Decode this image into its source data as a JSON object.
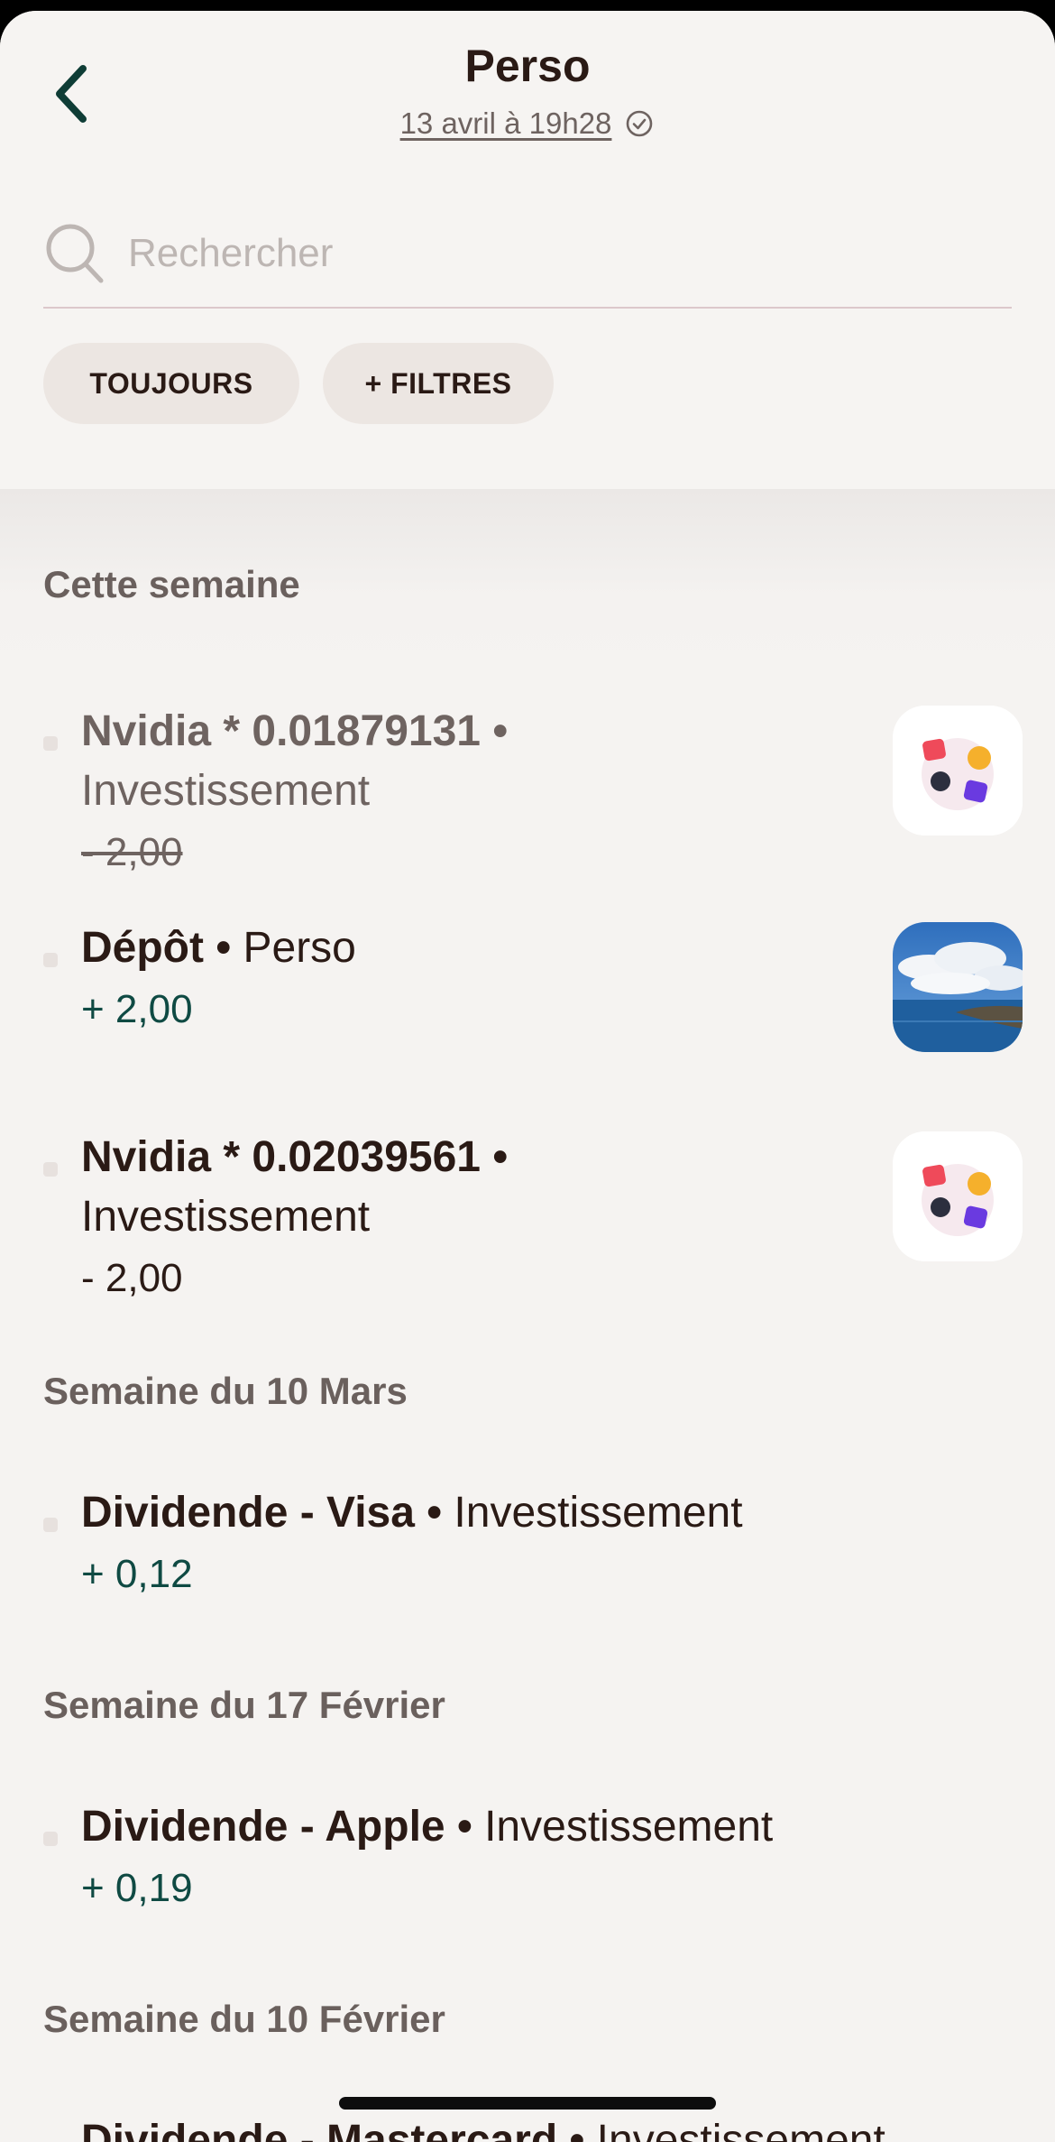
{
  "header": {
    "title": "Perso",
    "subtitle": "13 avril à 19h28",
    "back_icon": "chevron-left-icon",
    "check_icon": "check-circle-icon"
  },
  "search": {
    "placeholder": "Rechercher",
    "value": "",
    "icon": "search-icon"
  },
  "filters": {
    "period_label": "TOUJOURS",
    "more_label": "+ FILTRES"
  },
  "sections": [
    {
      "title": "Cette semaine",
      "items": [
        {
          "name": "Nvidia * 0.01879131",
          "separator": "•",
          "category": "Investissement",
          "amount": "- 2,00",
          "thumb": "invest-app-icon",
          "status": "cancelled"
        },
        {
          "name": "Dépôt",
          "separator": "•",
          "category": "Perso",
          "amount": "+ 2,00",
          "thumb": "sky-sea-photo",
          "status": "credit"
        },
        {
          "name": "Nvidia * 0.02039561",
          "separator": "•",
          "category": "Investissement",
          "amount": "- 2,00",
          "thumb": "invest-app-icon",
          "status": "debit"
        }
      ]
    },
    {
      "title": "Semaine du 10 Mars",
      "items": [
        {
          "name": "Dividende - Visa",
          "separator": "•",
          "category": "Investissement",
          "amount": "+ 0,12",
          "status": "credit"
        }
      ]
    },
    {
      "title": "Semaine du 17 Février",
      "items": [
        {
          "name": "Dividende - Apple",
          "separator": "•",
          "category": "Investissement",
          "amount": "+ 0,19",
          "status": "credit"
        }
      ]
    },
    {
      "title": "Semaine du 10 Février",
      "items": [
        {
          "name": "Dividende - Mastercard",
          "separator": "•",
          "category": "Investissement",
          "status": "credit"
        }
      ]
    }
  ],
  "colors": {
    "background": "#f6f4f2",
    "text": "#2a1a15",
    "muted": "#6e6360",
    "positive": "#0f4a43",
    "chip": "#ece6e2",
    "accent_dark_green": "#0f3d36"
  }
}
